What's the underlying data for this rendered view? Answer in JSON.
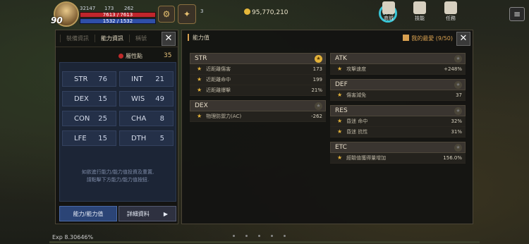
{
  "hud": {
    "level": "90",
    "hp": "7613 / 7613",
    "mp": "1532 / 1532",
    "mini_a": "32147",
    "mini_b": "173",
    "mini_c": "262",
    "gold": "95,770,210",
    "count": "3",
    "ring_pct": "67%",
    "icons": [
      {
        "name": "shop-icon",
        "label": "商城"
      },
      {
        "name": "skill-icon",
        "label": "技能"
      },
      {
        "name": "quest-icon",
        "label": "任務"
      }
    ],
    "menu_icon": "≡"
  },
  "left_panel": {
    "tabs": [
      "裝備資訊",
      "能力資訊",
      "稱號"
    ],
    "active_tab": 1,
    "attribute_label": "屬性點",
    "attribute_value": "35",
    "stats": [
      {
        "name": "STR",
        "value": "76"
      },
      {
        "name": "INT",
        "value": "21"
      },
      {
        "name": "DEX",
        "value": "15"
      },
      {
        "name": "WIS",
        "value": "49"
      },
      {
        "name": "CON",
        "value": "25"
      },
      {
        "name": "CHA",
        "value": "8"
      },
      {
        "name": "LFE",
        "value": "15"
      },
      {
        "name": "DTH",
        "value": "5"
      }
    ],
    "notice_line1": "如欲進行能力/能力值投資及重置,",
    "notice_line2": "請點擊下方能力/能力值按鈕.",
    "btn_ability": "能力/能力值",
    "btn_detail": "詳細資料"
  },
  "right_panel": {
    "title": "能力值",
    "favorites": "我的最愛 (9/50)",
    "left_groups": [
      {
        "name": "STR",
        "starred": true,
        "rows": [
          {
            "label": "近距離傷害",
            "value": "173"
          },
          {
            "label": "近距離命中",
            "value": "199"
          },
          {
            "label": "近距離爆擊",
            "value": "21%"
          }
        ]
      },
      {
        "name": "DEX",
        "starred": false,
        "rows": [
          {
            "label": "物理防禦力(AC)",
            "value": "-262"
          }
        ]
      }
    ],
    "right_groups": [
      {
        "name": "ATK",
        "starred": false,
        "rows": [
          {
            "label": "攻擊速度",
            "value": "+248%"
          }
        ]
      },
      {
        "name": "DEF",
        "starred": false,
        "rows": [
          {
            "label": "傷害減免",
            "value": "37"
          }
        ]
      },
      {
        "name": "RES",
        "starred": false,
        "rows": [
          {
            "label": "昏迷 命中",
            "value": "32%"
          },
          {
            "label": "昏迷 抗性",
            "value": "31%"
          }
        ]
      },
      {
        "name": "ETC",
        "starred": false,
        "rows": [
          {
            "label": "經驗值獲得量增加",
            "value": "156.0%"
          }
        ]
      }
    ]
  },
  "bottom": {
    "exp": "Exp 8.30646%"
  }
}
